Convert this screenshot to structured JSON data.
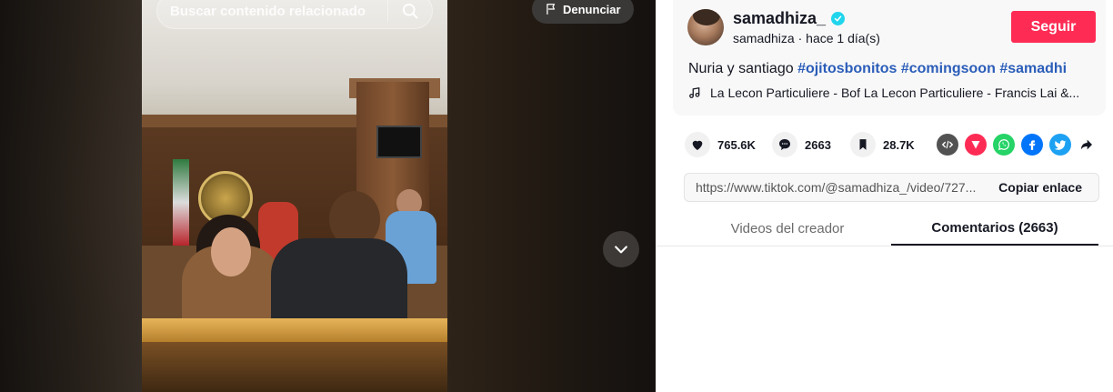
{
  "search": {
    "placeholder": "Buscar contenido relacionado"
  },
  "report": {
    "label": "Denunciar"
  },
  "creator": {
    "username": "samadhiza_",
    "handle": "samadhiza",
    "separator": " · ",
    "posted": "hace 1 día(s)",
    "follow_label": "Seguir"
  },
  "description": {
    "text": "Nuria y santiago ",
    "hashtags": [
      "#ojitosbonitos",
      "#comingsoon",
      "#samadhi"
    ]
  },
  "music": {
    "title": "La Lecon Particuliere - Bof La Lecon Particuliere - Francis Lai &..."
  },
  "stats": {
    "likes": "765.6K",
    "comments": "2663",
    "saves": "28.7K"
  },
  "share": {
    "icons": [
      "embed-icon",
      "send-icon",
      "whatsapp-icon",
      "facebook-icon",
      "twitter-icon",
      "share-arrow-icon"
    ]
  },
  "link": {
    "url": "https://www.tiktok.com/@samadhiza_/video/727...",
    "copy_label": "Copiar enlace"
  },
  "tabs": {
    "creator_videos": "Videos del creador",
    "comments": "Comentarios (2663)"
  },
  "colors": {
    "accent": "#fe2c55",
    "hashtag": "#2b5db9",
    "verified": "#20d5ec"
  }
}
